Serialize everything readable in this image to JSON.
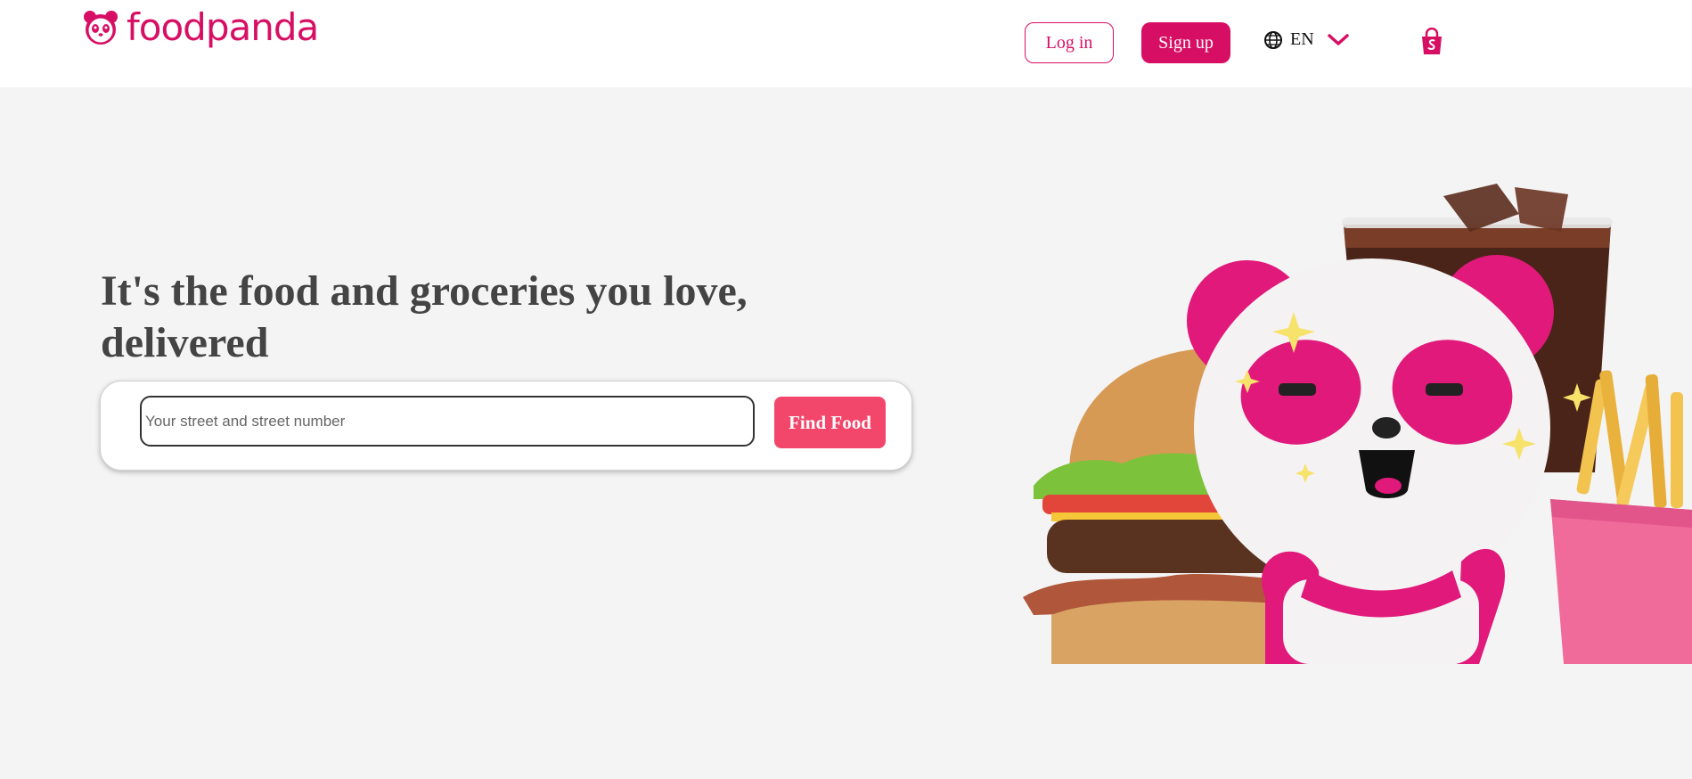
{
  "header": {
    "brand": "foodpanda",
    "login_label": "Log in",
    "signup_label": "Sign up",
    "language": "EN",
    "icons": [
      "panda-logo-icon",
      "globe-icon",
      "chevron-down-icon",
      "shopping-bag-icon"
    ]
  },
  "hero": {
    "title": "It's the food and groceries you love, delivered",
    "search_placeholder": "Your street and street number",
    "search_value": "",
    "find_button_label": "Find Food",
    "illustration": "panda-mascot-with-burger-drink-fries"
  },
  "colors": {
    "brand": "#d70f64",
    "find_button": "#f2466b",
    "background": "#f4f4f4",
    "title": "#444444"
  }
}
